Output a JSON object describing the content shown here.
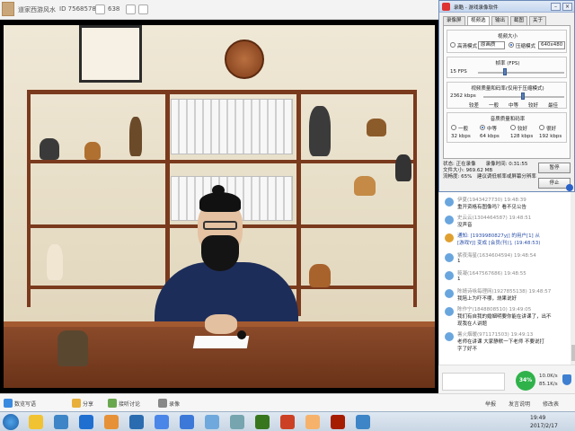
{
  "titlebar": {
    "room_name": "道家西游风水",
    "room_id": "ID 75685789",
    "online_count": "638"
  },
  "dialog": {
    "title": "录酷 - 游戏录像软件",
    "tabs": [
      "录像屏",
      "视频选",
      "输出",
      "截图",
      "关于"
    ],
    "active_tab": "视频选",
    "size_group": {
      "label": "视频大小",
      "option_hd": "高清模式",
      "hd_select": "原画质",
      "option_compress": "压缩模式",
      "compress_select": "640x480"
    },
    "fps_group": {
      "label": "帧率 (FPS)",
      "value": "15 FPS"
    },
    "quality_group": {
      "label": "视频质量和码率(仅用于压缩模式)",
      "value": "2362 kbps",
      "levels": [
        "较差",
        "一般",
        "中等",
        "较好",
        "最佳"
      ]
    },
    "audio_group": {
      "label": "音质质量和码率",
      "options": [
        "一般",
        "中等",
        "较好",
        "很好"
      ],
      "rates": [
        "32 kbps",
        "64 kbps",
        "128 kbps",
        "192 kbps"
      ],
      "selected": "中等"
    },
    "status": {
      "line1": "状态: 正在录像　　录像时间: 0:31:55",
      "line2": "文件大小: 969.62 MB",
      "line3": "流畅度: 65%　建议调低帧率或屏幕分辨率"
    },
    "pause_button": "暂停",
    "stop_button": "停止"
  },
  "chat": {
    "messages": [
      {
        "who": "伊夏(1943427730)  19:48:39",
        "text": "重开资格有图像吗？看不见公告"
      },
      {
        "who": "史云云(1304464587)  19:48:51",
        "text": "没声音"
      },
      {
        "who": "通知: [1939980827yj] 的用户[1] 从",
        "text": "[游戏YJ] 变成 [会员(刊)], (19:48:53)"
      },
      {
        "who": "紫夜海星(1634604594)  19:48:54",
        "text": "1"
      },
      {
        "who": "筱凝(1647567686)  19:48:55",
        "text": "1"
      },
      {
        "who": "陈婧诗咏每理网(1927855138)  19:48:57",
        "text": "我陪上为吓不哪，烧果说好"
      },
      {
        "who": "陈作宁(1848808510)  19:49:05",
        "text": "我们有自我的婚姻明要你能在讲课了，出不"
      },
      {
        "who": "",
        "text": "现我在人讲题"
      },
      {
        "who": "暑火烟暖(971171503)  19:49:13",
        "text": "老师在讲课 大家静默一下老师 不要说打"
      },
      {
        "who": "",
        "text": "字了好不"
      }
    ]
  },
  "lower": {
    "percent": "34%",
    "up_speed": "10.0K/s",
    "down_speed": "85.1K/s"
  },
  "toolbar": {
    "left_label": "数览写语",
    "mid_label1": "分享",
    "mid_label2": "接听讨论",
    "mid_label3": "录像",
    "right_label1": "举报",
    "right_label2": "发言说明",
    "right_label3": "修改表"
  },
  "taskbar": {
    "time": "19:49",
    "date": "2017/2/17"
  },
  "colors": {
    "dialog_border": "#6b8ab8",
    "accent_green": "#2fb24a",
    "robe_blue": "#1d2d5a"
  }
}
